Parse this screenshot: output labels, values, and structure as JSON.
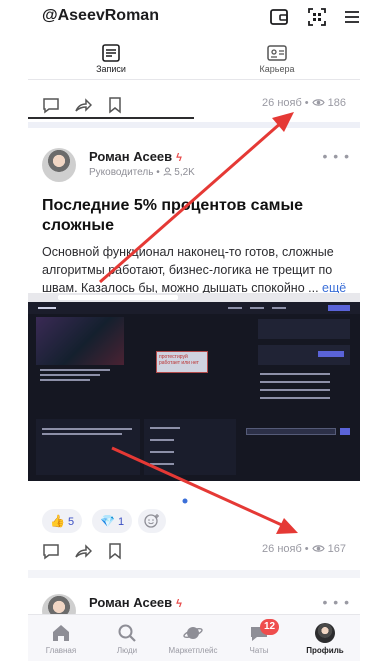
{
  "header": {
    "username": "@AseevRoman",
    "icons": [
      "wallet-icon",
      "qr-scan-icon",
      "menu-icon"
    ]
  },
  "tabs": [
    {
      "label": "Записи",
      "icon": "posts-icon",
      "active": true
    },
    {
      "label": "Карьера",
      "icon": "career-card-icon",
      "active": false
    }
  ],
  "prev_post": {
    "date": "26 нояб",
    "views": "186"
  },
  "post": {
    "author": {
      "name": "Роман Асеев",
      "role": "Руководитель",
      "followers": "5,2K"
    },
    "title": "Последние 5% процентов самые сложные",
    "body": "Основной функционал наконец-то готов, сложные алгоритмы работают, бизнес-логика не трещит по швам. Казалось бы, можно дышать спокойно ...",
    "more_label": "ещё",
    "screenshot_note": "протестируй работает или нет",
    "reactions": [
      {
        "emoji": "👍",
        "count": "5"
      },
      {
        "emoji": "💎",
        "count": "1"
      }
    ],
    "date": "26 нояб",
    "views": "167"
  },
  "next_post": {
    "author_name": "Роман Асеев"
  },
  "bottom_nav": [
    {
      "label": "Главная",
      "icon": "home-icon"
    },
    {
      "label": "Люди",
      "icon": "search-icon"
    },
    {
      "label": "Маркетплейс",
      "icon": "marketplace-planet-icon"
    },
    {
      "label": "Чаты",
      "icon": "chat-icon",
      "badge": "12"
    },
    {
      "label": "Профиль",
      "icon": "profile-avatar-icon",
      "active": true
    }
  ],
  "colors": {
    "accent_red": "#e53935",
    "badge_red": "#ef4d4d",
    "link_blue": "#3b6fd8",
    "muted": "#9a9aa3"
  }
}
